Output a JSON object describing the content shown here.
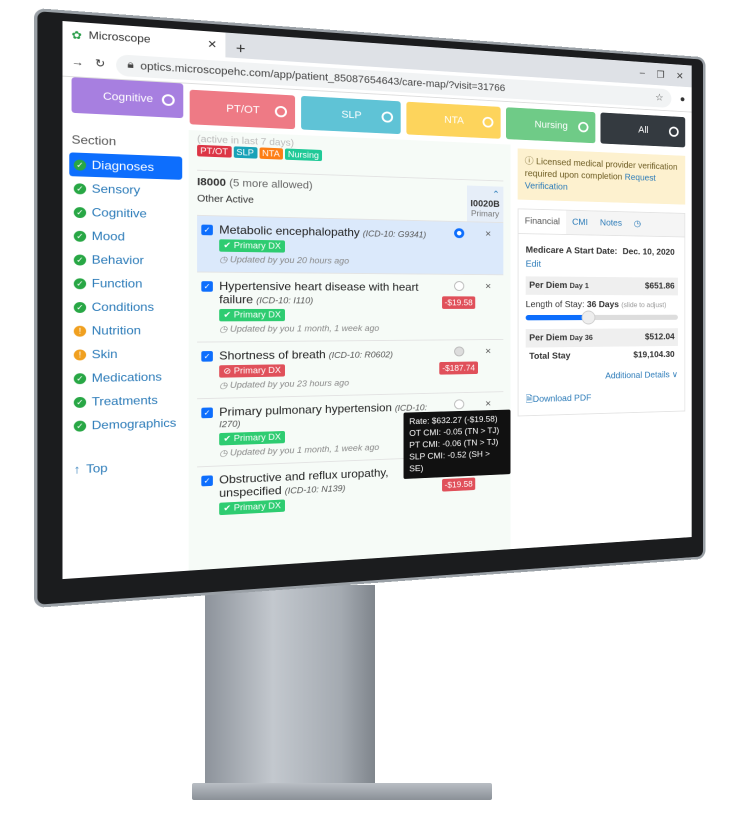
{
  "browser": {
    "tab_title": "Microscope",
    "url": "optics.microscopehc.com/app/patient_85087654643/care-map/?visit=31766"
  },
  "pills": [
    {
      "label": "Cognitive",
      "color": "#a77fe0"
    },
    {
      "label": "PT/OT",
      "color": "#ee7a85"
    },
    {
      "label": "SLP",
      "color": "#5fc3d6"
    },
    {
      "label": "NTA",
      "color": "#fdd45c"
    },
    {
      "label": "Nursing",
      "color": "#6fcb87"
    },
    {
      "label": "All",
      "color": "#343a40"
    }
  ],
  "sidebar": {
    "title": "Section",
    "items": [
      {
        "label": "Diagnoses",
        "status": "ok",
        "active": true
      },
      {
        "label": "Sensory",
        "status": "ok"
      },
      {
        "label": "Cognitive",
        "status": "ok"
      },
      {
        "label": "Mood",
        "status": "ok"
      },
      {
        "label": "Behavior",
        "status": "ok"
      },
      {
        "label": "Function",
        "status": "ok"
      },
      {
        "label": "Conditions",
        "status": "ok"
      },
      {
        "label": "Nutrition",
        "status": "warn"
      },
      {
        "label": "Skin",
        "status": "warn"
      },
      {
        "label": "Medications",
        "status": "ok"
      },
      {
        "label": "Treatments",
        "status": "ok"
      },
      {
        "label": "Demographics",
        "status": "ok"
      }
    ],
    "top": "Top"
  },
  "main": {
    "faded": "(active in last 7 days)",
    "tags": [
      {
        "label": "PT/OT",
        "color": "#dc3545"
      },
      {
        "label": "SLP",
        "color": "#17a2b8"
      },
      {
        "label": "NTA",
        "color": "#fd7e14"
      },
      {
        "label": "Nursing",
        "color": "#20c997"
      }
    ],
    "code": "I8000",
    "allowed": "(5 more allowed)",
    "other": "Other Active",
    "col_code": "I0020B",
    "col_label": "Primary",
    "rows": [
      {
        "name": "Metabolic encephalopathy",
        "icd": "(ICD-10: G9341)",
        "badge": "✔ Primary DX",
        "badge_ok": true,
        "updated": "Updated by you 20 hours ago",
        "delta": "",
        "selected": true
      },
      {
        "name": "Hypertensive heart disease with heart failure",
        "icd": "(ICD-10: I110)",
        "badge": "✔ Primary DX",
        "badge_ok": true,
        "updated": "Updated by you 1 month, 1 week ago",
        "delta": "-$19.58"
      },
      {
        "name": "Shortness of breath",
        "icd": "(ICD-10: R0602)",
        "badge": "⊘ Primary DX",
        "badge_ok": false,
        "updated": "Updated by you 23 hours ago",
        "delta": "-$187.74"
      },
      {
        "name": "Primary pulmonary hypertension",
        "icd": "(ICD-10: I270)",
        "badge": "✔ Primary DX",
        "badge_ok": true,
        "updated": "Updated by you 1 month, 1 week ago",
        "delta": ""
      },
      {
        "name": "Obstructive and reflux uropathy, unspecified",
        "icd": "(ICD-10: N139)",
        "badge": "✔ Primary DX",
        "badge_ok": true,
        "updated": "",
        "delta": "-$19.58"
      }
    ],
    "tooltip": [
      "Rate: $632.27 (-$19.58)",
      "OT CMI: -0.05 (TN > TJ)",
      "PT CMI: -0.06 (TN > TJ)",
      "SLP CMI: -0.52 (SH > SE)"
    ]
  },
  "right": {
    "warning": "Licensed medical provider verification required upon completion",
    "request": "Request Verification",
    "tabs": [
      "Financial",
      "CMI",
      "Notes"
    ],
    "start_label": "Medicare A Start Date:",
    "start_value": "Dec. 10, 2020",
    "edit": "Edit",
    "pd1_label": "Per Diem",
    "pd1_day": "Day 1",
    "pd1_value": "$651.86",
    "los_label": "Length of Stay:",
    "los_value": "36 Days",
    "los_hint": "(slide to adjust)",
    "los_fraction": 0.4,
    "pd2_label": "Per Diem",
    "pd2_day": "Day 36",
    "pd2_value": "$512.04",
    "total_label": "Total Stay",
    "total_value": "$19,104.30",
    "details": "Additional Details ∨",
    "download": "Download PDF"
  }
}
